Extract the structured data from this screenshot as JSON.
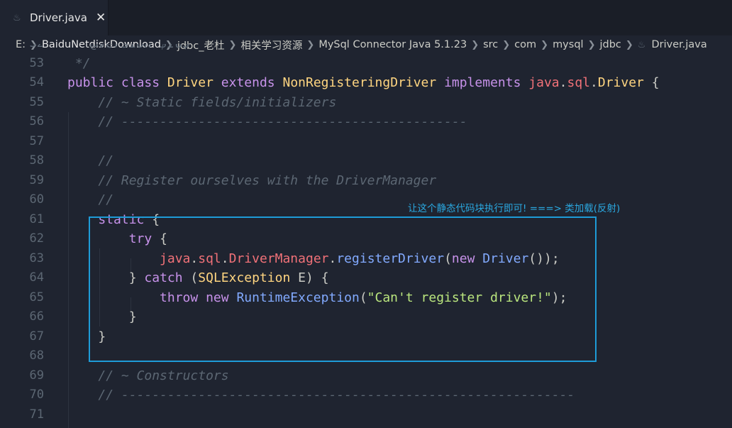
{
  "tab": {
    "label": "Driver.java",
    "close": "✕"
  },
  "breadcrumb": {
    "items": [
      "E:",
      "BaiduNetdiskDownload",
      "jdbc_老杜",
      "相关学习资源",
      "MySql Connector Java 5.1.23",
      "src",
      "com",
      "mysql",
      "jdbc",
      "Driver.java"
    ]
  },
  "editor": {
    "lines": [
      {
        "n": "52",
        "t": " * @version $Id$"
      },
      {
        "n": "53",
        "t": " */"
      },
      {
        "n": "54",
        "t": "public class Driver extends NonRegisteringDriver implements java.sql.Driver {"
      },
      {
        "n": "55",
        "t": "    // ~ Static fields/initializers"
      },
      {
        "n": "56",
        "t": "    // ---------------------------------------------"
      },
      {
        "n": "57",
        "t": ""
      },
      {
        "n": "58",
        "t": "    //"
      },
      {
        "n": "59",
        "t": "    // Register ourselves with the DriverManager"
      },
      {
        "n": "60",
        "t": "    //"
      },
      {
        "n": "61",
        "t": "    static {"
      },
      {
        "n": "62",
        "t": "        try {"
      },
      {
        "n": "63",
        "t": "            java.sql.DriverManager.registerDriver(new Driver());"
      },
      {
        "n": "64",
        "t": "        } catch (SQLException E) {"
      },
      {
        "n": "65",
        "t": "            throw new RuntimeException(\"Can't register driver!\");"
      },
      {
        "n": "66",
        "t": "        }"
      },
      {
        "n": "67",
        "t": "    }"
      },
      {
        "n": "68",
        "t": ""
      },
      {
        "n": "69",
        "t": "    // ~ Constructors"
      },
      {
        "n": "70",
        "t": "    // -----------------------------------------------------------"
      },
      {
        "n": "71",
        "t": ""
      }
    ]
  },
  "annotation": "让这个静态代码块执行即可! ===> 类加载(反射)",
  "colors": {
    "background": "#1f2430",
    "highlight_border": "#1e9bd7",
    "annotation": "#2aa8e0"
  },
  "icons": {
    "tab": "java-file-icon",
    "close": "close-icon",
    "separator": "chevron-right-icon"
  }
}
